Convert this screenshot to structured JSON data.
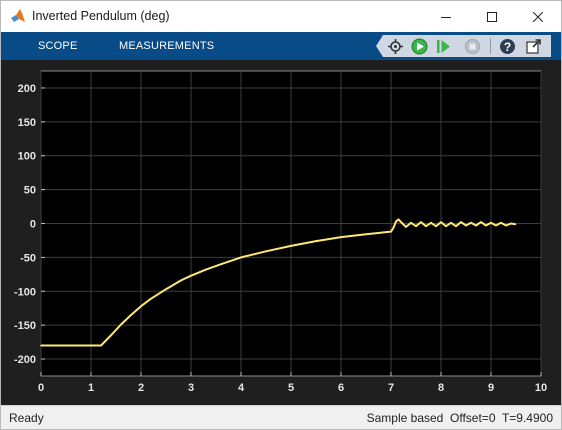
{
  "window": {
    "title": "Inverted Pendulum (deg)",
    "icon": "matlab-logo-icon"
  },
  "toolstrip": {
    "tabs": [
      "SCOPE",
      "MEASUREMENTS"
    ],
    "tools": [
      "highlight-simulink-block-icon",
      "run-icon",
      "step-forward-icon",
      "stop-icon",
      "help-icon",
      "undock-icon"
    ]
  },
  "status": {
    "state": "Ready",
    "mode": "Sample based",
    "offset": "Offset=0",
    "time": "T=9.4900"
  },
  "colors": {
    "toolstrip": "#094b87",
    "plot_background": "#1f1f1f",
    "axes_background": "#000000",
    "signal": "#ffe873",
    "grid": "#3d3d3d",
    "run_green": "#3bb64a"
  },
  "chart_data": {
    "type": "line",
    "title": "",
    "xlabel": "",
    "ylabel": "",
    "xlim": [
      0,
      10
    ],
    "ylim": [
      -225,
      225
    ],
    "xticks": [
      0,
      1,
      2,
      3,
      4,
      5,
      6,
      7,
      8,
      9,
      10
    ],
    "yticks": [
      -200,
      -150,
      -100,
      -50,
      0,
      50,
      100,
      150,
      200
    ],
    "grid": true,
    "series": [
      {
        "values_x": [
          0,
          0.5,
          1.0,
          1.2,
          1.4,
          1.6,
          1.8,
          2.0,
          2.2,
          2.5,
          2.8,
          3.0,
          3.3,
          3.6,
          4.0,
          4.5,
          5.0,
          5.5,
          6.0,
          6.5,
          7.0,
          7.05,
          7.1,
          7.15,
          7.2,
          7.3,
          7.4,
          7.5,
          7.6,
          7.7,
          7.8,
          7.9,
          8.0,
          8.1,
          8.2,
          8.3,
          8.4,
          8.5,
          8.6,
          8.7,
          8.8,
          8.9,
          9.0,
          9.1,
          9.2,
          9.3,
          9.4,
          9.49
        ],
        "values_y": [
          -180,
          -180,
          -180,
          -180,
          -165,
          -149,
          -135,
          -122,
          -111,
          -97,
          -84,
          -77,
          -68,
          -60,
          -50,
          -41,
          -33,
          -26,
          -20,
          -16,
          -12,
          -6,
          3,
          6,
          2,
          -5,
          1,
          -4,
          2,
          -4,
          1,
          -4,
          2,
          -4,
          1,
          -4,
          2,
          -3,
          1,
          -3,
          2,
          -3,
          1,
          -3,
          1,
          -3,
          0,
          -1
        ]
      }
    ]
  }
}
